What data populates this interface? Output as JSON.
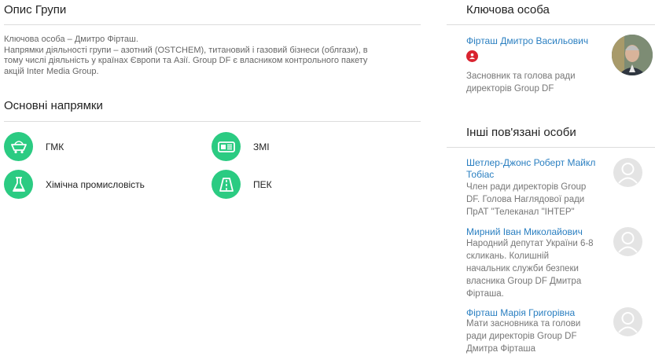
{
  "group_description": {
    "title": "Опис Групи",
    "line1": "Ключова особа – Дмитро Фірташ.",
    "line2": "Напрямки діяльності групи – азотний (OSTCHEM), титановий і газовий бізнеси (облгази), в",
    "line3": "тому числі діяльність у країнах Європи та Азії. Group DF є власником контрольного пакету",
    "line4": "акцій Inter Media Group."
  },
  "directions": {
    "title": "Основні напрямки",
    "items": [
      {
        "label": "ГМК",
        "icon": "mining-cart-icon"
      },
      {
        "label": "ЗМІ",
        "icon": "media-icon"
      },
      {
        "label": "Хімічна промисловість",
        "icon": "chemistry-flask-icon"
      },
      {
        "label": "ПЕК",
        "icon": "road-icon"
      }
    ]
  },
  "key_person": {
    "title": "Ключова особа",
    "name": "Фірташ Дмитро Васильович",
    "badge_icon": "person-badge-icon",
    "desc_line1": "Засновник та голова ради",
    "desc_line2": "директорів Group DF"
  },
  "related": {
    "title": "Інші пов'язані особи",
    "people": [
      {
        "name_line1": "Шетлер-Джонс Роберт Майкл",
        "name_line2": "Тобіас",
        "desc": [
          "Член ради директорів Group",
          "DF. Голова Наглядової ради",
          "ПрАТ \"Телеканал \"ІНТЕР\""
        ]
      },
      {
        "name_line1": "Мирний Іван Миколайович",
        "desc": [
          "Народний депутат України 6-8",
          "скликань. Колишній",
          "начальник служби безпеки",
          "власника Group DF Дмитра",
          "Фірташа."
        ]
      },
      {
        "name_line1": "Фірташ Марія Григорівна",
        "desc": [
          "Мати засновника та голови",
          "ради директорів Group DF",
          "Дмитра Фірташа"
        ]
      }
    ]
  },
  "colors": {
    "accent_green": "#2bcb82",
    "link_blue": "#2a7fc1",
    "badge_red": "#d9232f"
  }
}
